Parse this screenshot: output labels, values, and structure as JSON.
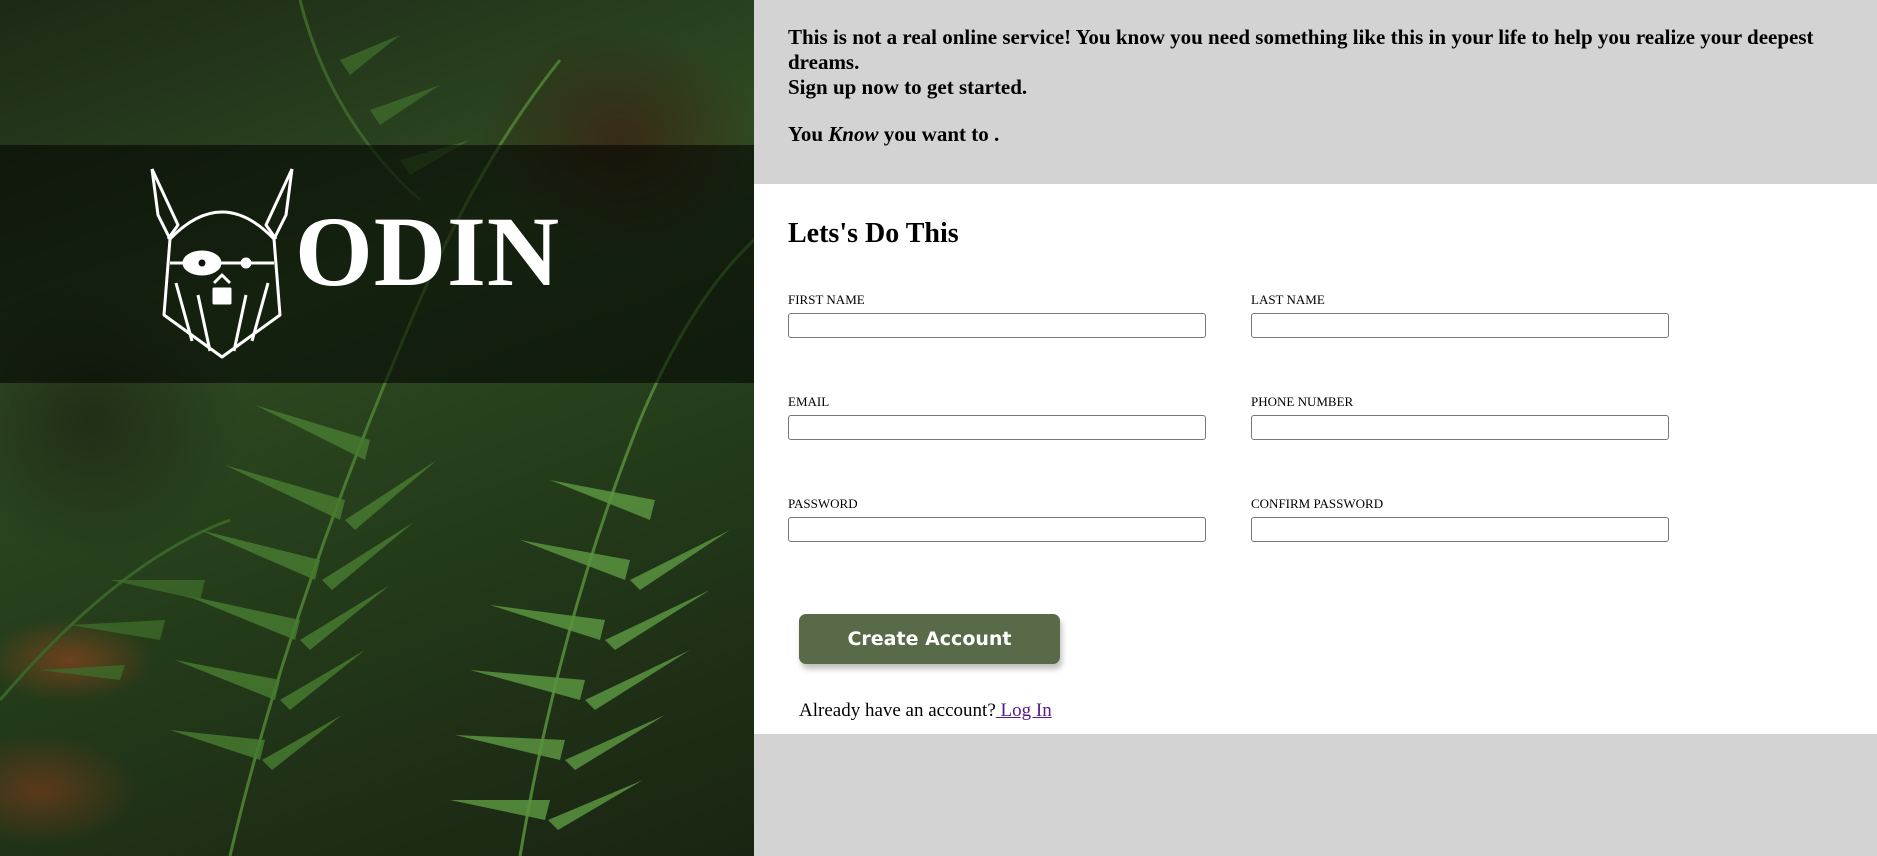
{
  "hero": {
    "brand_name": "ODIN",
    "logo_icon": "viking-head-icon"
  },
  "intro": {
    "line1": "This is not a real online service! You know you need something like this in your life to help you realize your deepest dreams.",
    "line2": "Sign up now to get started.",
    "tagline_prefix": "You ",
    "tagline_emphasis": "Know",
    "tagline_suffix": " you want to ."
  },
  "form": {
    "title": "Lets's Do This",
    "fields": {
      "first_name": {
        "label": "FIRST NAME",
        "value": ""
      },
      "last_name": {
        "label": "LAST NAME",
        "value": ""
      },
      "email": {
        "label": "EMAIL",
        "value": ""
      },
      "phone": {
        "label": "PHONE NUMBER",
        "value": ""
      },
      "password": {
        "label": "PASSWORD",
        "value": ""
      },
      "confirm_password": {
        "label": "CONFIRM PASSWORD",
        "value": ""
      }
    },
    "submit_label": "Create Account",
    "login_prompt": "Already have an account?",
    "login_link": " Log In"
  },
  "colors": {
    "button_bg": "#596a48",
    "panel_gray": "#d3d3d3",
    "link": "#551a8b"
  }
}
